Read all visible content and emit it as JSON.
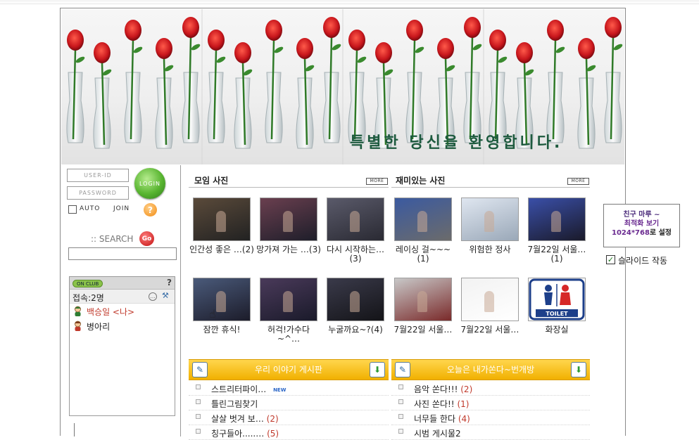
{
  "banner": {
    "text": "특별한 당신을 환영합니다."
  },
  "login": {
    "user_id_placeholder": "USER-ID",
    "password_placeholder": "PASSWORD",
    "login_button": "LOGIN",
    "auto_label": "AUTO",
    "join_label": "JOIN",
    "help_label": "?",
    "search_label": ":: SEARCH",
    "go_button": "Go"
  },
  "club": {
    "badge": "ON CLUB",
    "help": "?",
    "count_text": "접속:2명",
    "members": [
      {
        "name": "백승일 <나>",
        "is_me": true
      },
      {
        "name": "병아리",
        "is_me": false
      }
    ]
  },
  "sections": {
    "meeting_photos": {
      "title": "모임 사진",
      "more": "MORE"
    },
    "fun_photos": {
      "title": "재미있는 사진",
      "more": "MORE"
    }
  },
  "photos": [
    {
      "caption": "인간성 좋은 …(2)",
      "colors": [
        "#5a4a3a",
        "#222"
      ]
    },
    {
      "caption": "망가져 가는 …(3)",
      "colors": [
        "#6a3f4f",
        "#1e1e2a"
      ]
    },
    {
      "caption": "다시 시작하는…(3)",
      "colors": [
        "#5a5a6a",
        "#2a2a33"
      ]
    },
    {
      "caption": "레이싱 걸~~~(1)",
      "colors": [
        "#3b5aa0",
        "#6b6b6b"
      ]
    },
    {
      "caption": "위험한 정사",
      "colors": [
        "#dfe6f0",
        "#9aa8b8"
      ]
    },
    {
      "caption": "7월22일 서울…(1)",
      "colors": [
        "#3a4fa8",
        "#1a1a2a"
      ]
    },
    {
      "caption": "잠깐 휴식!",
      "colors": [
        "#4a5a7a",
        "#1c1c2a"
      ]
    },
    {
      "caption": "허걱!가수다~^…",
      "colors": [
        "#4a3a5a",
        "#1a1a2a"
      ]
    },
    {
      "caption": "누굴까요~?(4)",
      "colors": [
        "#3a3a4a",
        "#141418"
      ]
    },
    {
      "caption": "7월22일 서울…",
      "colors": [
        "#c8c8c8",
        "#7a2a2a"
      ]
    },
    {
      "caption": "7월22일 서울…",
      "colors": [
        "#f2f2f2",
        "#ffffff"
      ]
    },
    {
      "caption": "화장실",
      "colors": [
        "#ffffff",
        "#ffffff"
      ]
    }
  ],
  "boards": [
    {
      "title": "우리 이야기 게시판",
      "posts": [
        {
          "title": "스트리터파이…",
          "count": "",
          "new": "NEW"
        },
        {
          "title": "틀린그림찾기",
          "count": "",
          "new": ""
        },
        {
          "title": "살살 벗겨 보…",
          "count": "(2)",
          "new": ""
        },
        {
          "title": "칭구들아.....…",
          "count": "(5)",
          "new": ""
        }
      ]
    },
    {
      "title": "오늘은 내가쏜다~번개방",
      "posts": [
        {
          "title": "음악 쏜다!!!",
          "count": "(2)",
          "new": ""
        },
        {
          "title": "사진 쏜다!!",
          "count": "(1)",
          "new": ""
        },
        {
          "title": "너무들 한다",
          "count": "(4)",
          "new": ""
        },
        {
          "title": "시범 게시물2",
          "count": "",
          "new": ""
        }
      ]
    }
  ],
  "side": {
    "line1": "친구 마루 ~",
    "line2": "최적화 보기",
    "line3_res": "1024*768",
    "line3_tail": "로 설정",
    "slide_check": "✓",
    "slide_label": "슬라이드 작동"
  },
  "toilet_text": "TOILET"
}
